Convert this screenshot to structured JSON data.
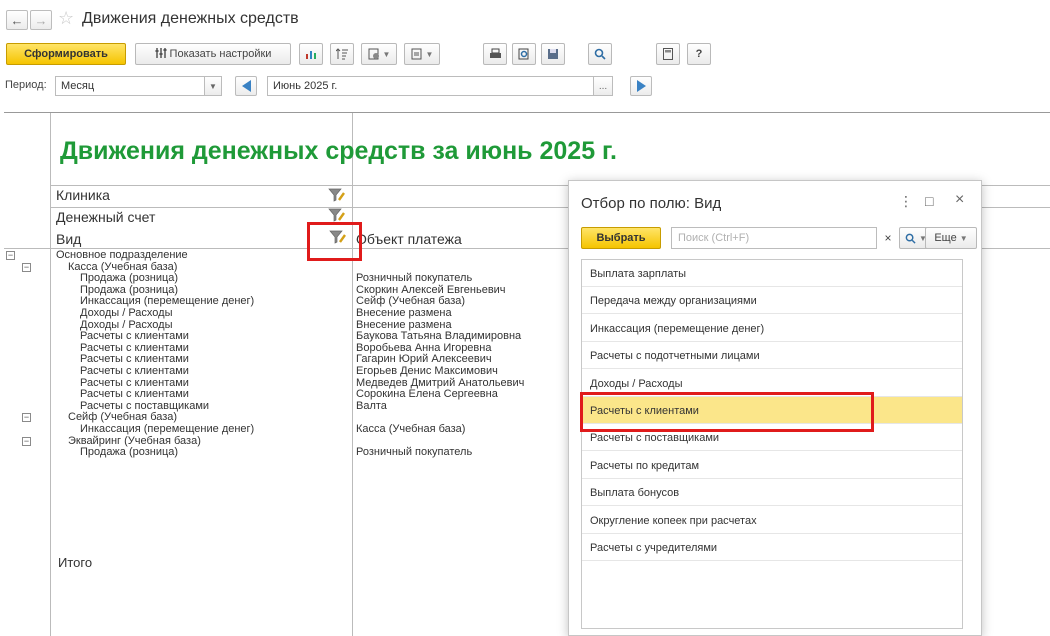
{
  "window": {
    "title": "Движения денежных средств",
    "nav_back": "←",
    "nav_forward": "→",
    "star": "☆"
  },
  "toolbar": {
    "generate": "Сформировать",
    "show_settings": "Показать настройки",
    "help": "?"
  },
  "period": {
    "label": "Период:",
    "type_value": "Месяц",
    "date_value": "Июнь 2025 г.",
    "dots": "..."
  },
  "report": {
    "title": "Движения денежных средств за июнь 2025 г.",
    "headers": {
      "clinic": "Клиника",
      "account": "Денежный счет",
      "kind": "Вид",
      "object": "Объект платежа"
    },
    "rows": [
      {
        "level": 0,
        "c1": "Основное подразделение",
        "c2": "",
        "exp": "−"
      },
      {
        "level": 1,
        "c1": "Касса (Учебная база)",
        "c2": "",
        "exp": "−"
      },
      {
        "level": 2,
        "c1": "Продажа (розница)",
        "c2": "Розничный покупатель"
      },
      {
        "level": 2,
        "c1": "Продажа (розница)",
        "c2": "Скоркин Алексей Евгеньевич"
      },
      {
        "level": 2,
        "c1": "Инкассация (перемещение денег)",
        "c2": "Сейф (Учебная база)"
      },
      {
        "level": 2,
        "c1": "Доходы / Расходы",
        "c2": "Внесение размена"
      },
      {
        "level": 2,
        "c1": "Доходы / Расходы",
        "c2": "Внесение размена"
      },
      {
        "level": 2,
        "c1": "Расчеты с клиентами",
        "c2": "Баукова Татьяна Владимировна"
      },
      {
        "level": 2,
        "c1": "Расчеты с клиентами",
        "c2": "Воробьева Анна Игоревна"
      },
      {
        "level": 2,
        "c1": "Расчеты с клиентами",
        "c2": "Гагарин Юрий Алексеевич"
      },
      {
        "level": 2,
        "c1": "Расчеты с клиентами",
        "c2": "Егорьев Денис Максимович"
      },
      {
        "level": 2,
        "c1": "Расчеты с клиентами",
        "c2": "Медведев Дмитрий Анатольевич"
      },
      {
        "level": 2,
        "c1": "Расчеты с клиентами",
        "c2": "Сорокина Елена Сергеевна"
      },
      {
        "level": 2,
        "c1": "Расчеты с поставщиками",
        "c2": "Валта"
      },
      {
        "level": 1,
        "c1": "Сейф (Учебная база)",
        "c2": "",
        "exp": "−"
      },
      {
        "level": 2,
        "c1": "Инкассация (перемещение денег)",
        "c2": "Касса (Учебная база)"
      },
      {
        "level": 1,
        "c1": "Эквайринг (Учебная база)",
        "c2": "",
        "exp": "−"
      },
      {
        "level": 2,
        "c1": "Продажа (розница)",
        "c2": "Розничный покупатель"
      }
    ],
    "total": "Итого"
  },
  "popup": {
    "title": "Отбор по полю: Вид",
    "menu_icon": "⋮",
    "maximize_icon": "□",
    "close_icon": "×",
    "select_button": "Выбрать",
    "search_placeholder": "Поиск (Ctrl+F)",
    "clear": "×",
    "more": "Еще",
    "items": [
      "Выплата зарплаты",
      "Передача между организациями",
      "Инкассация (перемещение денег)",
      "Расчеты с подотчетными лицами",
      "Доходы / Расходы",
      "Расчеты с клиентами",
      "Расчеты с поставщиками",
      "Расчеты по кредитам",
      "Выплата бонусов",
      "Округление копеек при расчетах",
      "Расчеты с учредителями"
    ],
    "selected_index": 5
  },
  "colors": {
    "accent": "#f5c400",
    "title_green": "#1f9a38",
    "highlight_red": "#e01b1b",
    "selection": "#fbe68a"
  }
}
